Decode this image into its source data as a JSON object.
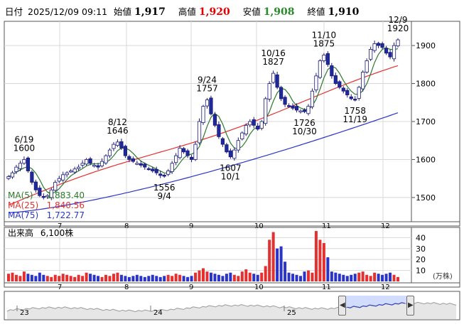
{
  "header": {
    "date_label": "日付",
    "datetime": "2025/12/09 09:11",
    "open_label": "始値",
    "open_value": "1,917",
    "high_label": "高値",
    "high_value": "1,920",
    "low_label": "安値",
    "low_value": "1,908",
    "close_label": "終値",
    "close_value": "1,910"
  },
  "legend": [
    {
      "name": "MA(5)",
      "value": "1,883.40",
      "color": "#2d7a2d"
    },
    {
      "name": "MA(25)",
      "value": "1,840.56",
      "color": "#e53030"
    },
    {
      "name": "MA(75)",
      "value": "1,722.77",
      "color": "#2b34c8"
    }
  ],
  "volume_panel": {
    "label": "出来高",
    "value": "6,100株",
    "unit": "(万株)"
  },
  "navigator": {
    "labels": [
      "23",
      "24",
      "25"
    ]
  },
  "chart_data": [
    {
      "type": "candlestick",
      "title": "",
      "x_tick_labels": [
        "7",
        "8",
        "9",
        "10",
        "11",
        "12"
      ],
      "y_tick_labels": [
        "1500",
        "1600",
        "1700",
        "1800",
        "1900"
      ],
      "ylim": [
        1440,
        1960
      ],
      "grid": true,
      "legend_position": "top-left-bottom",
      "annotations": [
        {
          "date": "6/19",
          "value": "1600"
        },
        {
          "date": "8/12",
          "value": "1646"
        },
        {
          "date": "9/24",
          "value": "1757"
        },
        {
          "date": "10/16",
          "value": "1827"
        },
        {
          "date": "11/10",
          "value": "1875"
        },
        {
          "date": "12/9",
          "value": "1920"
        },
        {
          "date": "9/4",
          "value": "1556"
        },
        {
          "date": "10/1",
          "value": "1607"
        },
        {
          "date": "10/30",
          "value": "1726"
        },
        {
          "date": "11/19",
          "value": "1758"
        }
      ],
      "closes": [
        1555,
        1565,
        1580,
        1590,
        1600,
        1570,
        1540,
        1520,
        1505,
        1500,
        1505,
        1520,
        1540,
        1550,
        1560,
        1565,
        1570,
        1575,
        1580,
        1590,
        1600,
        1590,
        1585,
        1580,
        1595,
        1610,
        1625,
        1640,
        1646,
        1630,
        1610,
        1600,
        1595,
        1590,
        1585,
        1580,
        1575,
        1570,
        1565,
        1558,
        1556,
        1570,
        1590,
        1610,
        1630,
        1620,
        1610,
        1600,
        1640,
        1700,
        1740,
        1757,
        1720,
        1690,
        1660,
        1640,
        1620,
        1607,
        1625,
        1650,
        1670,
        1690,
        1700,
        1690,
        1680,
        1700,
        1760,
        1800,
        1827,
        1790,
        1760,
        1745,
        1740,
        1735,
        1730,
        1728,
        1726,
        1740,
        1780,
        1820,
        1860,
        1875,
        1850,
        1820,
        1800,
        1790,
        1780,
        1770,
        1760,
        1758,
        1790,
        1830,
        1860,
        1890,
        1905,
        1900,
        1895,
        1880,
        1870,
        1900,
        1915
      ],
      "series": [
        {
          "name": "MA(5)",
          "last": 1883.4
        },
        {
          "name": "MA(25)",
          "last": 1840.56
        },
        {
          "name": "MA(75)",
          "last": 1722.77
        }
      ]
    },
    {
      "type": "bar",
      "title": "",
      "x_tick_labels": [
        "7",
        "8",
        "9",
        "10",
        "11",
        "12"
      ],
      "y_tick_labels": [
        "10",
        "20",
        "30",
        "40"
      ],
      "ylim": [
        0,
        48
      ],
      "values": [
        7,
        8,
        6,
        5,
        9,
        7,
        6,
        5,
        8,
        6,
        5,
        4,
        6,
        5,
        7,
        6,
        5,
        4,
        6,
        5,
        8,
        7,
        6,
        5,
        4,
        6,
        5,
        7,
        8,
        6,
        5,
        4,
        5,
        6,
        5,
        4,
        5,
        6,
        5,
        4,
        5,
        6,
        5,
        7,
        6,
        5,
        4,
        5,
        8,
        10,
        12,
        9,
        8,
        7,
        6,
        5,
        7,
        8,
        6,
        5,
        9,
        11,
        8,
        7,
        6,
        8,
        14,
        38,
        45,
        30,
        32,
        18,
        8,
        7,
        6,
        5,
        9,
        10,
        8,
        46,
        38,
        35,
        22,
        9,
        8,
        7,
        6,
        5,
        6,
        7,
        8,
        9,
        6,
        5,
        8,
        7,
        6,
        7,
        8,
        6,
        4
      ]
    }
  ]
}
